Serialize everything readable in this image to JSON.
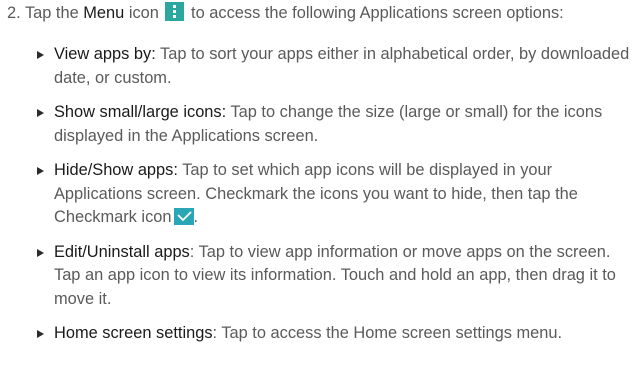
{
  "step": {
    "number": "2.",
    "text_before": "Tap the",
    "menu_word": "Menu",
    "text_icon": "icon",
    "text_after": "to access the following Applications screen options:"
  },
  "icons": {
    "menu_icon": "menu-icon",
    "checkmark_icon": "checkmark-icon",
    "colors": {
      "menu_icon": "#2aa8a0",
      "checkmark_icon": "#2ba6b4"
    }
  },
  "items": [
    {
      "label": "View apps by:",
      "text": "Tap to sort your apps either in alphabetical order, by downloaded date, or custom."
    },
    {
      "label": "Show small/large icons:",
      "text": "Tap to change the size (large or small) for the icons displayed in the Applications screen."
    },
    {
      "label": "Hide/Show apps:",
      "text": "Tap to set which app icons will be displayed in your Applications screen. Checkmark the icons you want to hide, then tap the Checkmark icon",
      "text_end": "."
    },
    {
      "label": "Edit/Uninstall apps",
      "text": ": Tap to view app information or move apps on the screen. Tap an app icon to view its information. Touch and hold an app, then drag it to move it."
    },
    {
      "label": "Home screen settings",
      "text": ": Tap to access the Home screen settings menu."
    }
  ]
}
